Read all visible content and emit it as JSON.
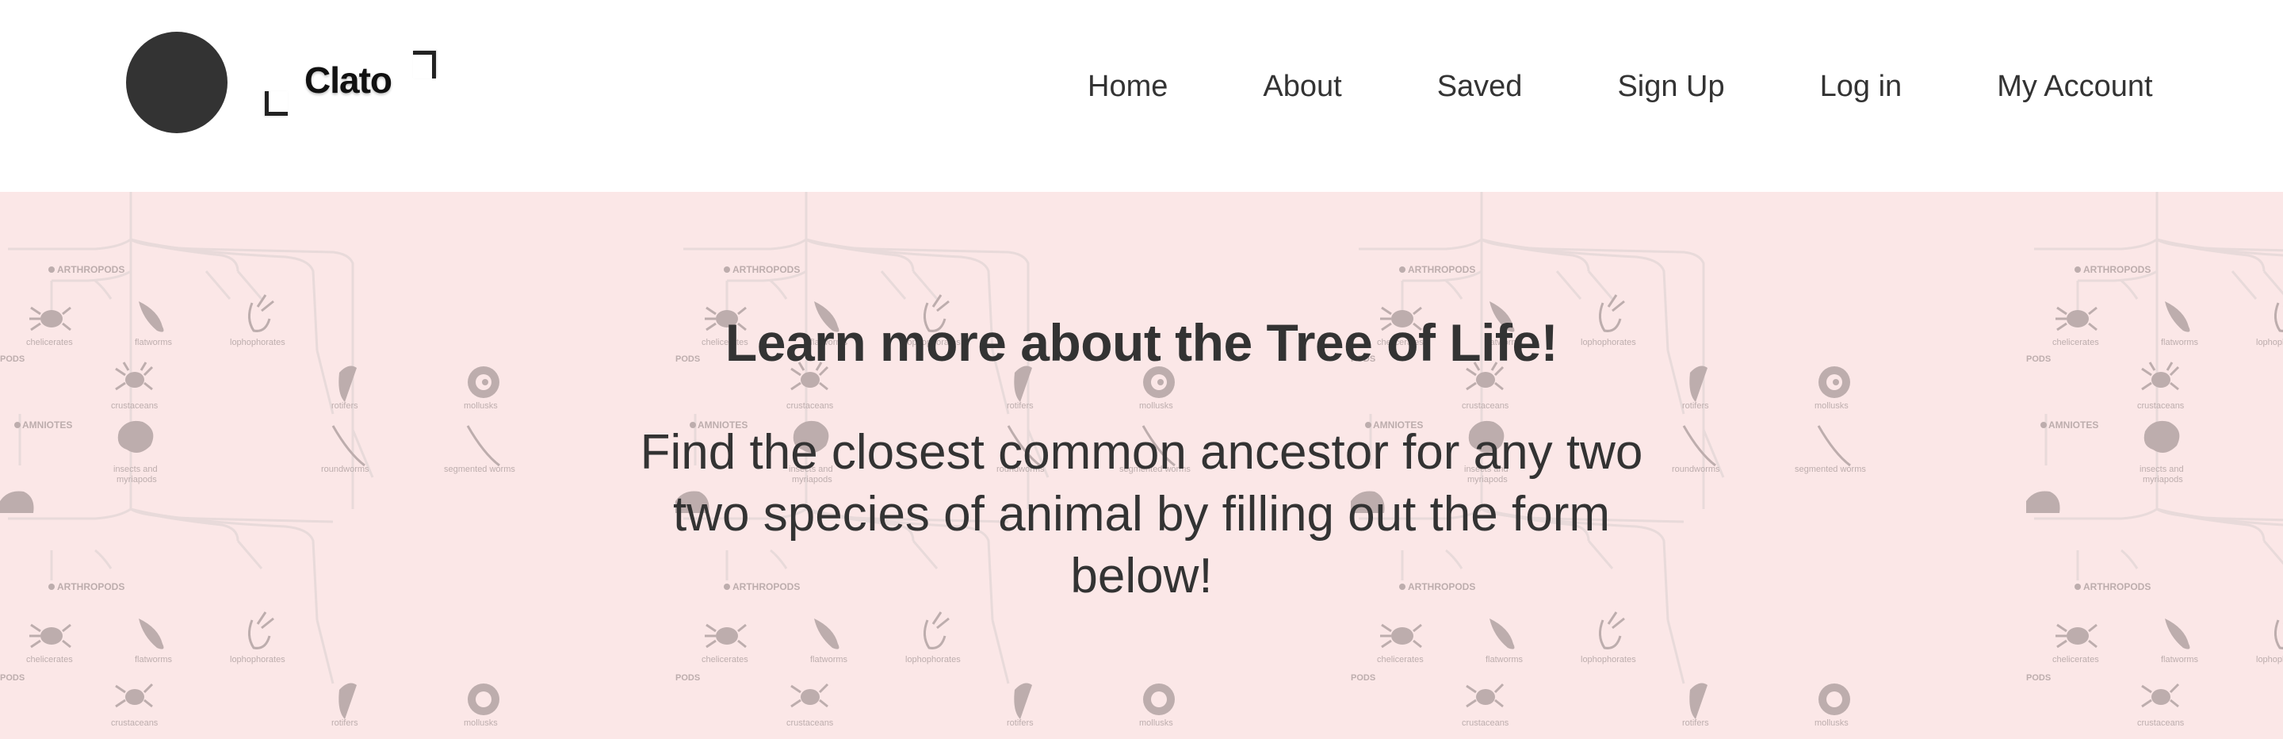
{
  "brand": {
    "name": "Clato"
  },
  "nav": {
    "items": [
      {
        "label": "Home"
      },
      {
        "label": "About"
      },
      {
        "label": "Saved"
      },
      {
        "label": "Sign Up"
      },
      {
        "label": "Log in"
      },
      {
        "label": "My Account"
      }
    ]
  },
  "hero": {
    "title": "Learn more about the Tree of Life!",
    "subtitle": "Find the closest common ancestor for any two two species of animal by filling out the form below!",
    "background_labels": {
      "group1": "ARTHROPODS",
      "group2": "AMNIOTES",
      "group3": "PODS",
      "species": [
        "chelicerates",
        "flatworms",
        "lophophorates",
        "crustaceans",
        "rotifers",
        "mollusks",
        "insects and myriapods",
        "roundworms",
        "segmented worms"
      ]
    }
  },
  "colors": {
    "hero_background": "#fbe7e7",
    "text": "#333333",
    "logo": "#333333",
    "tree_lines": "#d9cfcf",
    "tree_icons": "#8a7f7f"
  }
}
